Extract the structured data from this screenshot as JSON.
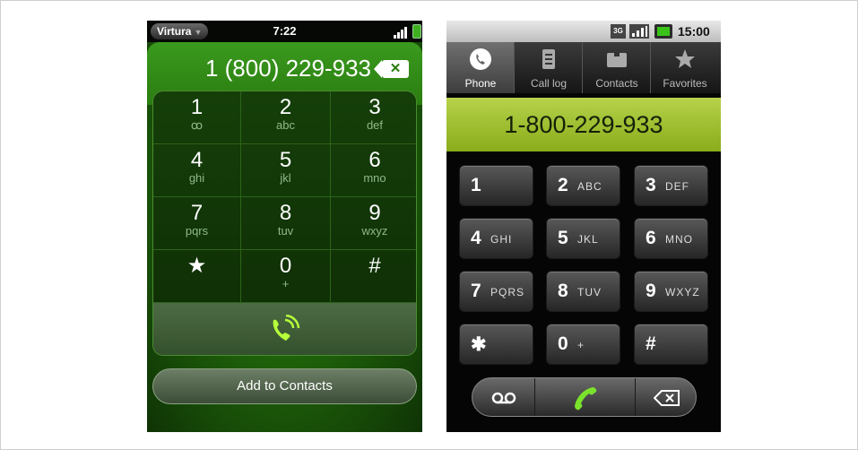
{
  "left_phone": {
    "status": {
      "carrier": "Virtura",
      "time": "7:22",
      "icons": [
        "signal-icon",
        "battery-icon"
      ]
    },
    "display": {
      "number": "1 (800) 229-933",
      "backspace_glyph": "✕"
    },
    "keys": [
      {
        "digit": "1",
        "letters": "ꝏ"
      },
      {
        "digit": "2",
        "letters": "abc"
      },
      {
        "digit": "3",
        "letters": "def"
      },
      {
        "digit": "4",
        "letters": "ghi"
      },
      {
        "digit": "5",
        "letters": "jkl"
      },
      {
        "digit": "6",
        "letters": "mno"
      },
      {
        "digit": "7",
        "letters": "pqrs"
      },
      {
        "digit": "8",
        "letters": "tuv"
      },
      {
        "digit": "9",
        "letters": "wxyz"
      },
      {
        "digit": "★",
        "letters": ""
      },
      {
        "digit": "0",
        "letters": "+"
      },
      {
        "digit": "#",
        "letters": ""
      }
    ],
    "add_to_contacts": "Add to Contacts",
    "colors": {
      "accent": "#2a7d10",
      "call": "#b6ff3a"
    }
  },
  "right_phone": {
    "status": {
      "network": "3G",
      "time": "15:00",
      "icons": [
        "3g-icon",
        "signal-icon",
        "battery-icon"
      ]
    },
    "tabs": [
      {
        "label": "Phone",
        "icon": "phone-icon",
        "selected": true
      },
      {
        "label": "Call log",
        "icon": "call-log-icon",
        "selected": false
      },
      {
        "label": "Contacts",
        "icon": "contacts-icon",
        "selected": false
      },
      {
        "label": "Favorites",
        "icon": "star-icon",
        "selected": false
      }
    ],
    "number": "1-800-229-933",
    "keys": [
      {
        "digit": "1",
        "letters": ""
      },
      {
        "digit": "2",
        "letters": "ABC"
      },
      {
        "digit": "3",
        "letters": "DEF"
      },
      {
        "digit": "4",
        "letters": "GHI"
      },
      {
        "digit": "5",
        "letters": "JKL"
      },
      {
        "digit": "6",
        "letters": "MNO"
      },
      {
        "digit": "7",
        "letters": "PQRS"
      },
      {
        "digit": "8",
        "letters": "TUV"
      },
      {
        "digit": "9",
        "letters": "WXYZ"
      },
      {
        "digit": "✱",
        "letters": ""
      },
      {
        "digit": "0",
        "letters": "+"
      },
      {
        "digit": "#",
        "letters": ""
      }
    ],
    "bottom_bar": [
      "voicemail-icon",
      "call-icon",
      "backspace-icon"
    ],
    "colors": {
      "number_bar": "#9dbb2a",
      "call": "#7be22c"
    }
  }
}
